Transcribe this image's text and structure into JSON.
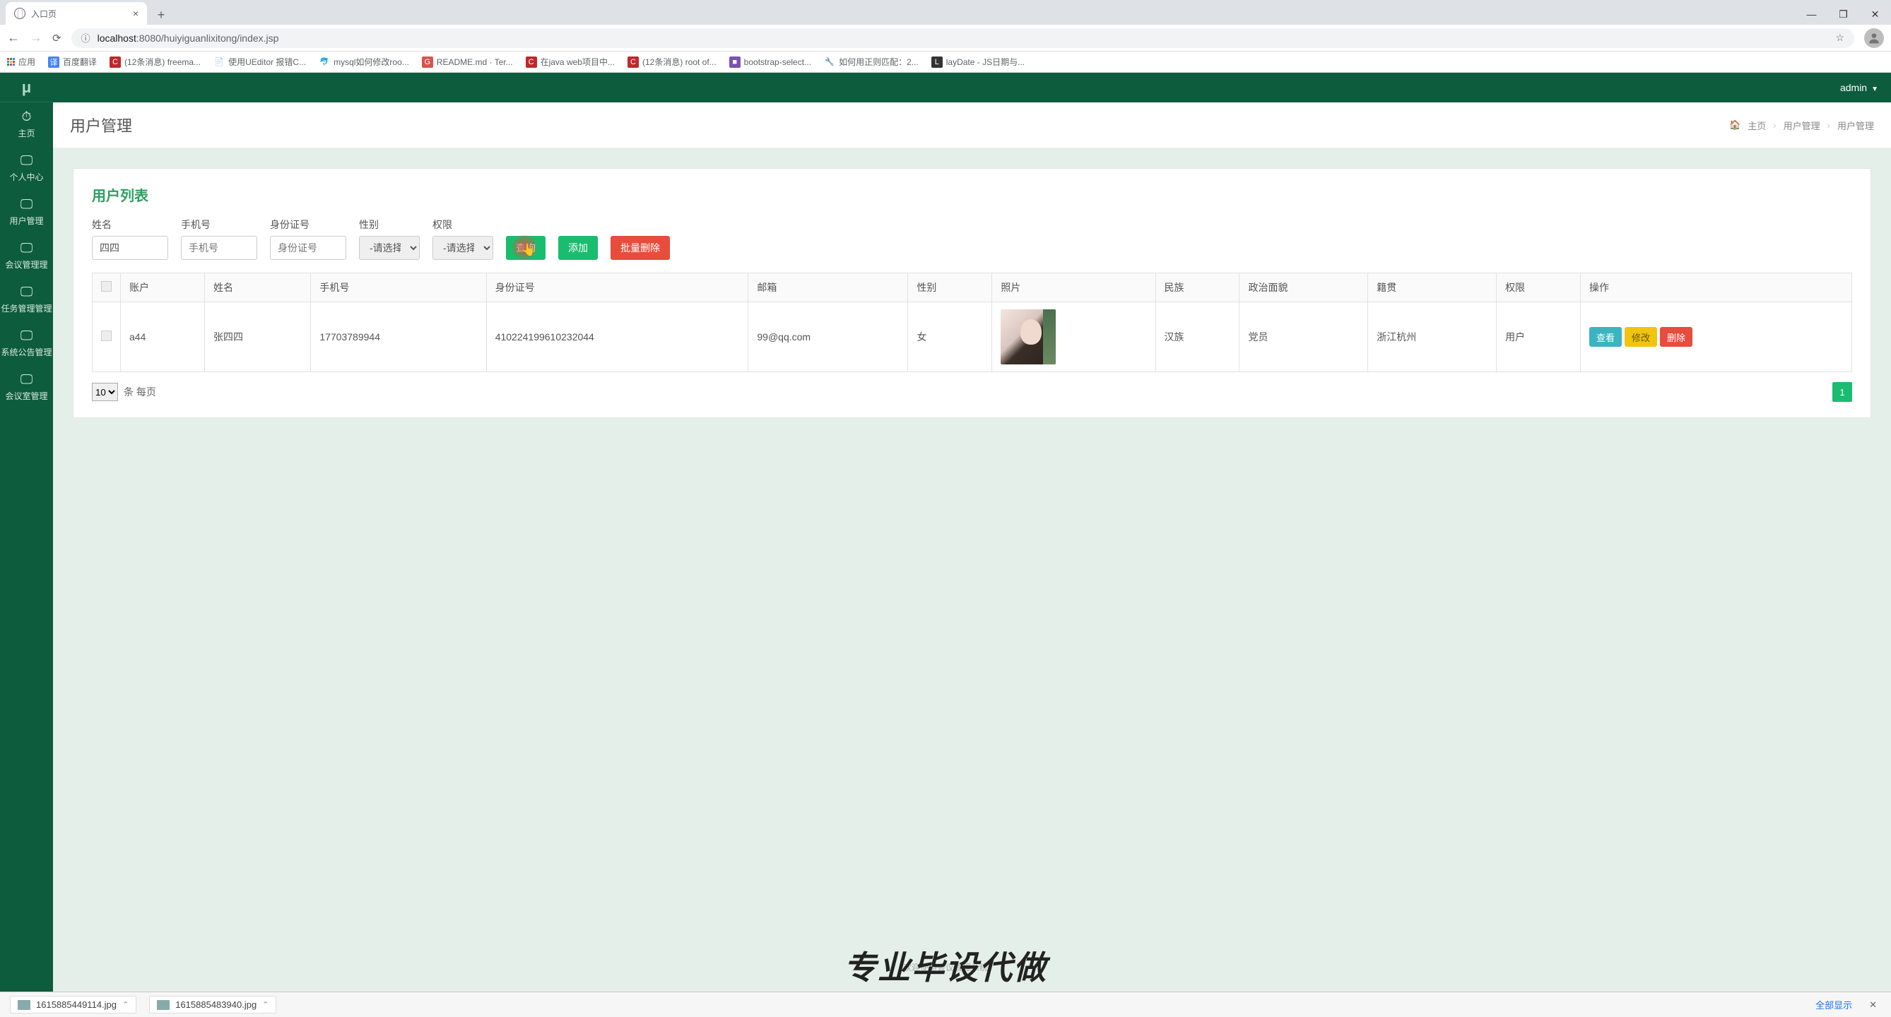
{
  "browser": {
    "tab_title": "入口页",
    "url_prefix": "localhost",
    "url_rest": ":8080/huiyiguanlixitong/index.jsp",
    "bookmarks": [
      "应用",
      "百度翻译",
      "(12条消息) freema...",
      "使用UEditor 报错C...",
      "mysql如何修改roo...",
      "README.md · Ter...",
      "在java web项目中...",
      "(12条消息) root of...",
      "bootstrap-select...",
      "如何用正则匹配：2...",
      "layDate - JS日期与..."
    ],
    "win": {
      "min": "—",
      "max": "❐",
      "close": "✕"
    }
  },
  "app": {
    "logo": "μ",
    "user": "admin",
    "sidebar": [
      {
        "icon": "⏱",
        "label": "主页"
      },
      {
        "icon": "🖵",
        "label": "个人中心"
      },
      {
        "icon": "🖵",
        "label": "用户管理"
      },
      {
        "icon": "🖵",
        "label": "会议管理理"
      },
      {
        "icon": "🖵",
        "label": "任务管理管理"
      },
      {
        "icon": "🖵",
        "label": "系统公告管理"
      },
      {
        "icon": "🖵",
        "label": "会议室管理"
      }
    ],
    "page_title": "用户管理",
    "breadcrumb": {
      "home": "主页",
      "b1": "用户管理",
      "b2": "用户管理"
    },
    "panel_title": "用户列表",
    "filters": {
      "name": {
        "label": "姓名",
        "value": "四四"
      },
      "phone": {
        "label": "手机号",
        "placeholder": "手机号"
      },
      "id": {
        "label": "身份证号",
        "placeholder": "身份证号"
      },
      "gender": {
        "label": "性别",
        "selected": "-请选择-"
      },
      "role": {
        "label": "权限",
        "selected": "-请选择-"
      }
    },
    "buttons": {
      "query": "查询",
      "add": "添加",
      "batch_delete": "批量删除"
    },
    "table": {
      "headers": [
        "",
        "账户",
        "姓名",
        "手机号",
        "身份证号",
        "邮箱",
        "性别",
        "照片",
        "民族",
        "政治面貌",
        "籍贯",
        "权限",
        "操作"
      ],
      "rows": [
        {
          "account": "a44",
          "name": "张四四",
          "phone": "17703789944",
          "id": "410224199610232044",
          "email": "99@qq.com",
          "gender": "女",
          "ethnic": "汉族",
          "politics": "党员",
          "origin": "浙江杭州",
          "role": "用户"
        }
      ],
      "actions": {
        "view": "查看",
        "edit": "修改",
        "delete": "删除"
      },
      "page_size": "10",
      "page_suffix": "条 每页",
      "current_page": "1"
    },
    "footer_faint": "欢迎使用会议管理系统",
    "overlay": "专业毕设代做"
  },
  "downloads": {
    "items": [
      "1615885449114.jpg",
      "1615885483940.jpg"
    ],
    "show_all": "全部显示"
  }
}
